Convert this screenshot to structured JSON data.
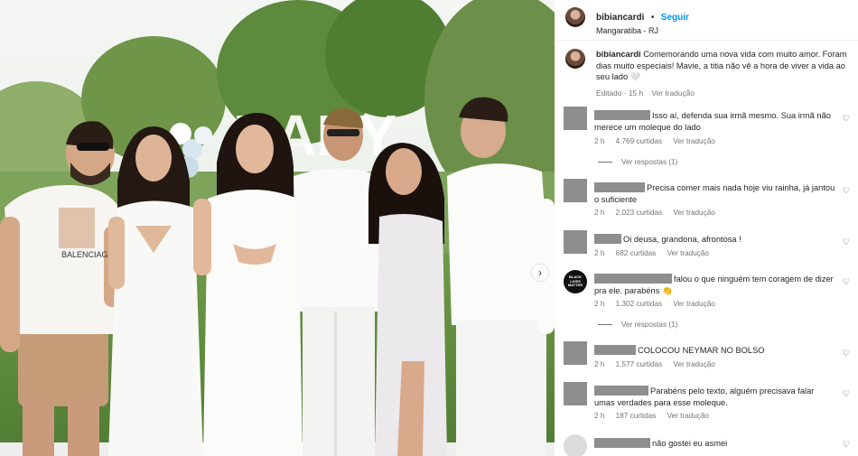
{
  "post": {
    "username": "bibiancardi",
    "separator": "•",
    "follow_label": "Seguir",
    "location": "Mangaratiba - RJ",
    "caption": "Comemorando uma nova vida com muito amor. Foram dias muito especiais! Mavie, a titia não vê a hora de viver a vida ao seu lado 🤍",
    "caption_meta": {
      "edited": "Editado · 15 h",
      "translate": "Ver tradução"
    }
  },
  "photo": {
    "sign_text": "BABY",
    "shirt_text": "BALENCIAGA"
  },
  "icons": {
    "next": "chevron-right-icon",
    "like": "heart-icon"
  },
  "comments": [
    {
      "text": "Isso aí, defenda sua irmã mesmo. Sua irmã não merece um moleque do lado",
      "time": "2 h",
      "likes": "4.769 curtidas",
      "translate": "Ver tradução",
      "replies": "Ver respostas (1)"
    },
    {
      "text": "Precisa comer mais nada hoje viu rainha, já jantou o suficiente",
      "time": "2 h",
      "likes": "2.023 curtidas",
      "translate": "Ver tradução"
    },
    {
      "text": "Oi deusa, grandona, afrontosa !",
      "time": "2 h",
      "likes": "682 curtidas",
      "translate": "Ver tradução"
    },
    {
      "text": "falou o que ninguém tem coragem de dizer pra ele. parabéns 👏",
      "time": "2 h",
      "likes": "1.302 curtidas",
      "translate": "Ver tradução",
      "replies": "Ver respostas (1)",
      "avatar_text": "BLACK LIVES MATTER"
    },
    {
      "text": "COLOCOU NEYMAR NO BOLSO",
      "time": "2 h",
      "likes": "1.577 curtidas",
      "translate": "Ver tradução"
    },
    {
      "text": "Parabéns pelo texto, alguém precisava falar umas verdades para esse moleque.",
      "time": "2 h",
      "likes": "187 curtidas",
      "translate": "Ver tradução"
    },
    {
      "text": "não gostei eu asmei"
    }
  ]
}
